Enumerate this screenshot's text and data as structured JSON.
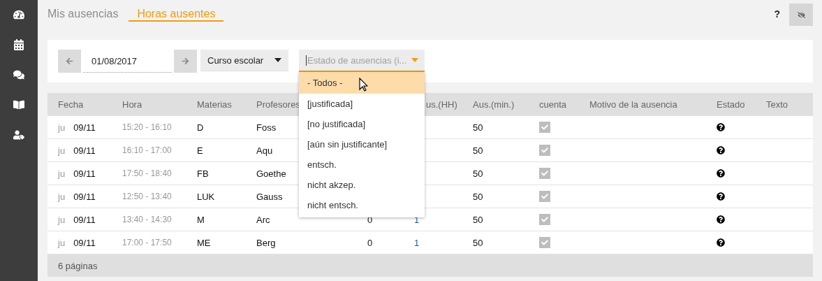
{
  "sidebar": {
    "items": [
      {
        "kind": "gauge",
        "selected": false
      },
      {
        "kind": "calendar",
        "selected": false
      },
      {
        "kind": "chat",
        "selected": false
      },
      {
        "kind": "book",
        "selected": false
      },
      {
        "kind": "person",
        "selected": false
      }
    ]
  },
  "tabs": [
    {
      "label": "Mis ausencias",
      "selected": false
    },
    {
      "label": "Horas ausentes",
      "selected": true
    }
  ],
  "help": "?",
  "filters": {
    "date": "01/08/2017",
    "period": "Curso escolar",
    "status_placeholder": "Estado de ausencias (i...",
    "status_open": true,
    "status_options": [
      {
        "label": "- Todos -",
        "selected": true
      },
      {
        "label": "[justificada]",
        "selected": false
      },
      {
        "label": "[no justificada]",
        "selected": false
      },
      {
        "label": "[aún sin justificante]",
        "selected": false
      },
      {
        "label": "entsch.",
        "selected": false
      },
      {
        "label": "nicht akzep.",
        "selected": false
      },
      {
        "label": "nicht entsch.",
        "selected": false
      }
    ]
  },
  "table": {
    "columns": [
      "Fecha",
      "Hora",
      "Materias",
      "Profesores",
      null,
      "us.(HH)",
      "Aus.(min.)",
      "cuenta",
      "Motivo de la ausencia",
      "Estado",
      "Texto"
    ],
    "rows": [
      {
        "day": "ju",
        "date": "09/11",
        "time": "15:20 - 16:10",
        "subject": "D",
        "teacher": "Foss",
        "minutes": "50",
        "counted": true,
        "status_set": false
      },
      {
        "day": "ju",
        "date": "09/11",
        "time": "16:10 - 17:00",
        "subject": "E",
        "teacher": "Aqu",
        "minutes": "50",
        "counted": true,
        "status_set": false
      },
      {
        "day": "ju",
        "date": "09/11",
        "time": "17:50 - 18:40",
        "subject": "FB",
        "teacher": "Goethe",
        "minutes": "50",
        "counted": true,
        "status_set": false
      },
      {
        "day": "ju",
        "date": "09/11",
        "time": "12:50 - 13:40",
        "subject": "LUK",
        "teacher": "Gauss",
        "minutes": "50",
        "counted": true,
        "status_set": false
      },
      {
        "day": "ju",
        "date": "09/11",
        "time": "13:40 - 14:30",
        "subject": "M",
        "teacher": "Arc",
        "column_5": "0",
        "column_6": "1",
        "minutes": "50",
        "counted": true,
        "status_set": false
      },
      {
        "day": "ju",
        "date": "09/11",
        "time": "17:00 - 17:50",
        "subject": "ME",
        "teacher": "Berg",
        "column_5": "0",
        "column_6": "1",
        "minutes": "50",
        "counted": true,
        "status_set": false
      }
    ],
    "footer": "6 páginas"
  }
}
